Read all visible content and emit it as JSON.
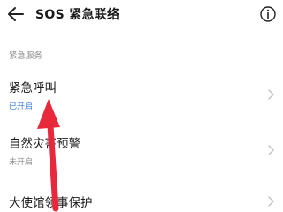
{
  "header": {
    "title": "SOS 紧急联络",
    "back_icon": "back-arrow-icon",
    "info_icon": "info-icon"
  },
  "section": {
    "label": "紧急服务"
  },
  "items": [
    {
      "label": "紧急呼叫",
      "status": "已开启",
      "status_color": "#3a7bd5"
    },
    {
      "label": "自然灾害预警",
      "status": "未开启",
      "status_color": "#8e8e8e"
    },
    {
      "label": "大使馆领事保护",
      "status": ""
    }
  ],
  "annotation": {
    "icon": "red-arrow-icon",
    "color": "#e8283b"
  }
}
